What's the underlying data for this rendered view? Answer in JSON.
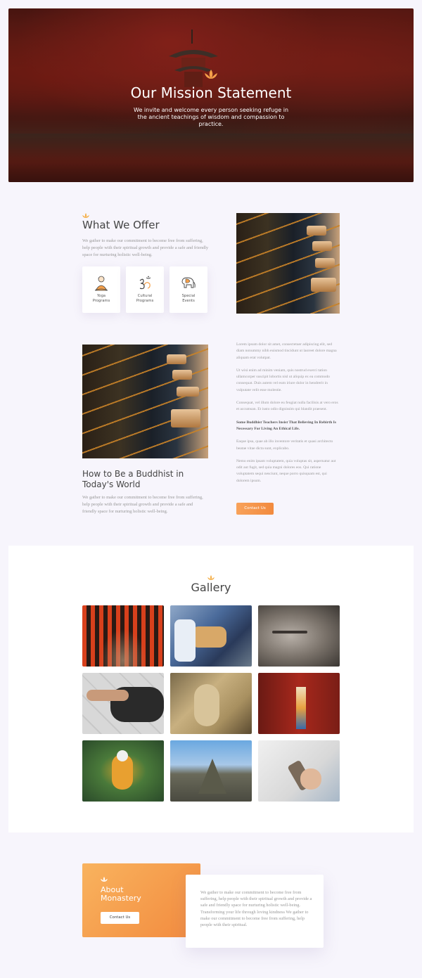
{
  "hero": {
    "title": "Our Mission Statement",
    "subtitle": "We invite and welcome every person seeking refuge in the ancient teachings of wisdom and compassion to practice."
  },
  "offer": {
    "title": "What We Offer",
    "description": "We gather to make our commitment to become free from suffering, help people with their spiritual growth and provide a safe and friendly space for nurturing holistic well-being.",
    "cards": [
      {
        "label": "Yoga\nPrograms",
        "icon": "meditating-monk-icon"
      },
      {
        "label": "Cultural\nPrograms",
        "icon": "om-symbol-icon"
      },
      {
        "label": "Special\nEvents",
        "icon": "elephant-icon"
      }
    ]
  },
  "buddhist": {
    "title": "How to Be a Buddhist in Today's World",
    "description": "We gather to make our commitment to become free from suffering, help people with their spiritual growth and provide a safe and friendly space for nurturing holistic well-being.",
    "paragraphs": [
      "Lorem ipsum dolor sit amet, consectetuer adipiscing elit, sed diam nonummy nibh euismod tincidunt ut laoreet dolore magna aliquam erat volutpat.",
      "Ut wisi enim ad minim veniam, quis nostrud exerci tation ullamcorper suscipit lobortis nisl ut aliquip ex ea commodo consequat. Duis autem vel eum iriure dolor in hendrerit in vulputate velit esse molestie.",
      "Consequat, vel illum dolore eu feugiat nulla facilisis at vero eros et accumsan. Et iusto odio dignissim qui blandit praesent."
    ],
    "bold_heading": "Some Buddhist Teachers Insist That Believing In Rebirth Is Necessary For Living An Ethical Life.",
    "paragraphs2": [
      "Eaque ipsa, quae ab illo inventore veritatis et quasi architecto beatae vitae dicta sunt, explicabo.",
      "Nemo enim ipsam voluptatem, quia voluptas sit, aspernatur aut odit aut fugit, sed quia magni dolores eos. Qui ratione voluptatem sequi nesciunt, neque porro quisquam est, qui dolorem ipsum."
    ],
    "button_label": "Contact Us"
  },
  "gallery": {
    "title": "Gallery"
  },
  "about": {
    "title": "About\nMonastery",
    "button_label": "Contact Us",
    "text": "We gather to make our commitment to become free from suffering, help people with their spiritual growth and provide a safe and friendly space for nurturing holistic well-being. Transforming your life through loving kindness We gather to make our commitment to become free from suffering, help people with their spiritual."
  },
  "colors": {
    "accent": "#f28a3e",
    "accent_light": "#f9b35e",
    "page_bg": "#f7f5fc"
  }
}
